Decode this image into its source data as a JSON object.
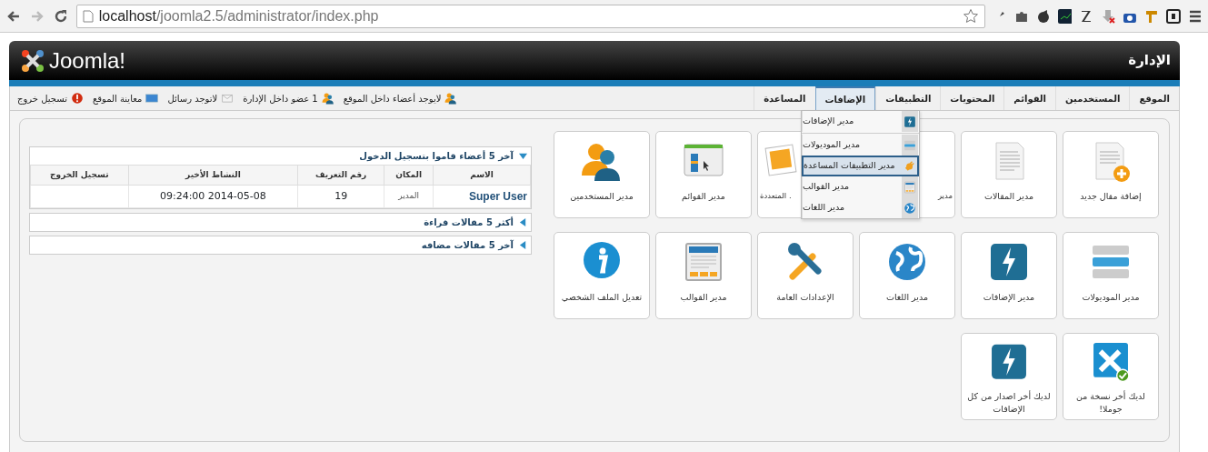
{
  "browser": {
    "url_host": "localhost",
    "url_path": "/joomla2.5/administrator/index.php"
  },
  "header": {
    "logo_text": "Joomla!",
    "title": "الإدارة"
  },
  "menu": [
    {
      "label": "الموقع",
      "selected": false
    },
    {
      "label": "المستخدمين",
      "selected": false
    },
    {
      "label": "القوائم",
      "selected": false
    },
    {
      "label": "المحتويات",
      "selected": false
    },
    {
      "label": "التطبيقات",
      "selected": false
    },
    {
      "label": "الإضافات",
      "selected": true
    },
    {
      "label": "المساعدة",
      "selected": false
    }
  ],
  "dropdown": [
    {
      "label": "مدير الإضافات",
      "kind": "bolt",
      "selected": false,
      "divider_after": true
    },
    {
      "label": "مدير الموديولات",
      "kind": "modules",
      "selected": false,
      "divider_after": false
    },
    {
      "label": "مدير التطبيقات المساعدة",
      "kind": "plugin",
      "selected": true,
      "divider_after": false
    },
    {
      "label": "مدير القوالب",
      "kind": "template",
      "selected": false,
      "divider_after": false
    },
    {
      "label": "مدير اللغات",
      "kind": "globe",
      "selected": false,
      "divider_after": false
    }
  ],
  "status": [
    {
      "label": "لايوجد أعضاء داخل الموقع",
      "kind": "users"
    },
    {
      "label": "1 عضو داخل الإدارة",
      "kind": "users"
    },
    {
      "label": "لاتوجد رسائل",
      "kind": "mail"
    },
    {
      "label": "معاينة الموقع",
      "kind": "screen"
    },
    {
      "label": "تسجيل خروج",
      "kind": "logout"
    }
  ],
  "quick_icons": [
    [
      {
        "label": "إضافة مقال جديد",
        "kind": "article-add"
      },
      {
        "label": "مدير المقالات",
        "kind": "article"
      },
      {
        "label": "مدير",
        "kind": "blank"
      },
      {
        "label": ". المتعددة",
        "kind": "media"
      },
      {
        "label": "مدير القوائم",
        "kind": "menu"
      },
      {
        "label": "مدير المستخدمين",
        "kind": "users"
      }
    ],
    [
      {
        "label": "مدير الموديولات",
        "kind": "modules"
      },
      {
        "label": "مدير الإضافات",
        "kind": "bolt"
      },
      {
        "label": "مدير اللغات",
        "kind": "globe"
      },
      {
        "label": "الإعدادات العامة",
        "kind": "tools"
      },
      {
        "label": "مدير القوالب",
        "kind": "template"
      },
      {
        "label": "تعديل الملف الشخصي",
        "kind": "info"
      }
    ],
    [
      {
        "label": "لديك أخر نسخة من جوملا!",
        "kind": "joomla-check"
      },
      {
        "label": "لديك أخر اصدار من كل الإضافات",
        "kind": "bolt"
      }
    ]
  ],
  "panels": [
    {
      "title": "آخر 5 أعضاء قاموا بتسجيل الدخول",
      "expanded": true,
      "table": {
        "columns": [
          "الاسم",
          "المكان",
          "رقم التعريف",
          "النشاط الأخير",
          "تسجيل الخروج"
        ],
        "rows": [
          [
            "Super User",
            "المدير",
            "19",
            "2014-05-08 09:24:00",
            ""
          ]
        ]
      }
    },
    {
      "title": "أكثر 5 مقالات قراءة",
      "expanded": false
    },
    {
      "title": "آخر 5 مقالات مضافه",
      "expanded": false
    }
  ]
}
